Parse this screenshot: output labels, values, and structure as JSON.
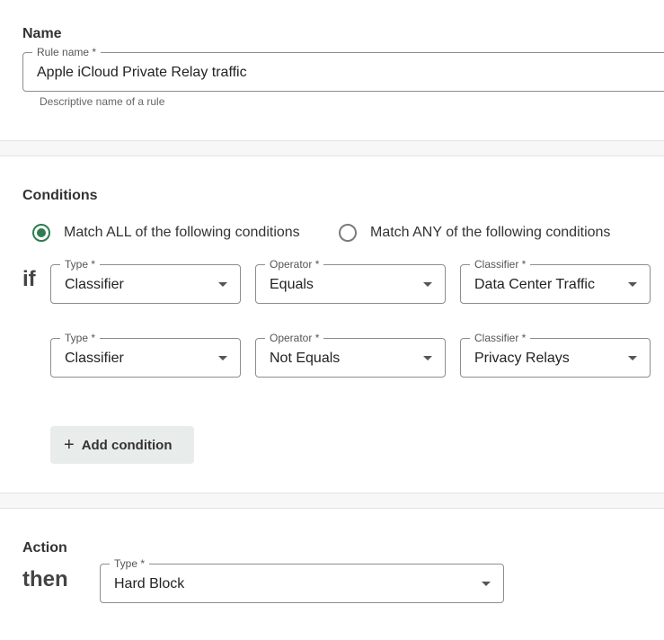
{
  "name_section": {
    "title": "Name",
    "rule_name": {
      "label": "Rule name *",
      "value": "Apple iCloud Private Relay traffic",
      "helper": "Descriptive name of a rule"
    }
  },
  "conditions_section": {
    "title": "Conditions",
    "match_options": [
      {
        "label": "Match ALL of the following conditions",
        "selected": true
      },
      {
        "label": "Match ANY of the following conditions",
        "selected": false
      }
    ],
    "if_keyword": "if",
    "rows": [
      {
        "type": {
          "label": "Type *",
          "value": "Classifier"
        },
        "operator": {
          "label": "Operator *",
          "value": "Equals"
        },
        "classifier": {
          "label": "Classifier *",
          "value": "Data Center Traffic"
        }
      },
      {
        "type": {
          "label": "Type *",
          "value": "Classifier"
        },
        "operator": {
          "label": "Operator *",
          "value": "Not Equals"
        },
        "classifier": {
          "label": "Classifier *",
          "value": "Privacy Relays"
        }
      }
    ],
    "add_condition_label": "Add condition",
    "add_icon": "+"
  },
  "action_section": {
    "title": "Action",
    "then_keyword": "then",
    "type": {
      "label": "Type *",
      "value": "Hard Block"
    }
  },
  "colors": {
    "accent": "#2e7d4f",
    "border": "#8d8d8d",
    "button_bg": "#e8ecea",
    "band": "#f7f7f7"
  }
}
